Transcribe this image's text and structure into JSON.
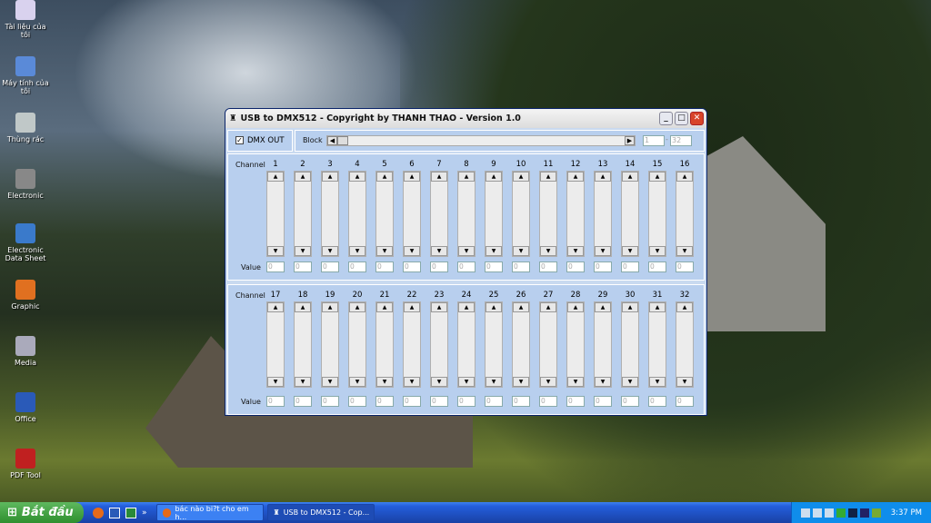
{
  "desktop": {
    "icons": [
      {
        "label": "Tài liệu của tôi",
        "color": "#d9d2ee"
      },
      {
        "label": "Máy tính của tôi",
        "color": "#5a8ad8"
      },
      {
        "label": "Thùng rác",
        "color": "#c0c8c8"
      },
      {
        "label": "Electronic",
        "color": "#888"
      },
      {
        "label": "Electronic Data Sheet",
        "color": "#3a7acb"
      },
      {
        "label": "Graphic",
        "color": "#e07020"
      },
      {
        "label": "Media",
        "color": "#aab"
      },
      {
        "label": "Office",
        "color": "#2a5ab8"
      },
      {
        "label": "PDF Tool",
        "color": "#c02020"
      }
    ]
  },
  "window": {
    "title": "USB to DMX512 - Copyright by THANH THAO - Version 1.0",
    "dmx_out_label": "DMX OUT",
    "dmx_out_checked": true,
    "block_label": "Block",
    "range_from": "1",
    "range_to": "32",
    "range_sep": "-",
    "channel_label": "Channel",
    "value_label": "Value",
    "bank1": [
      1,
      2,
      3,
      4,
      5,
      6,
      7,
      8,
      9,
      10,
      11,
      12,
      13,
      14,
      15,
      16
    ],
    "bank2": [
      17,
      18,
      19,
      20,
      21,
      22,
      23,
      24,
      25,
      26,
      27,
      28,
      29,
      30,
      31,
      32
    ],
    "default_value": "0"
  },
  "taskbar": {
    "start": "Bắt đầu",
    "tasks": [
      "bác nào bi?t cho em h...",
      "USB to DMX512 - Cop..."
    ],
    "clock": "3:37 PM"
  }
}
